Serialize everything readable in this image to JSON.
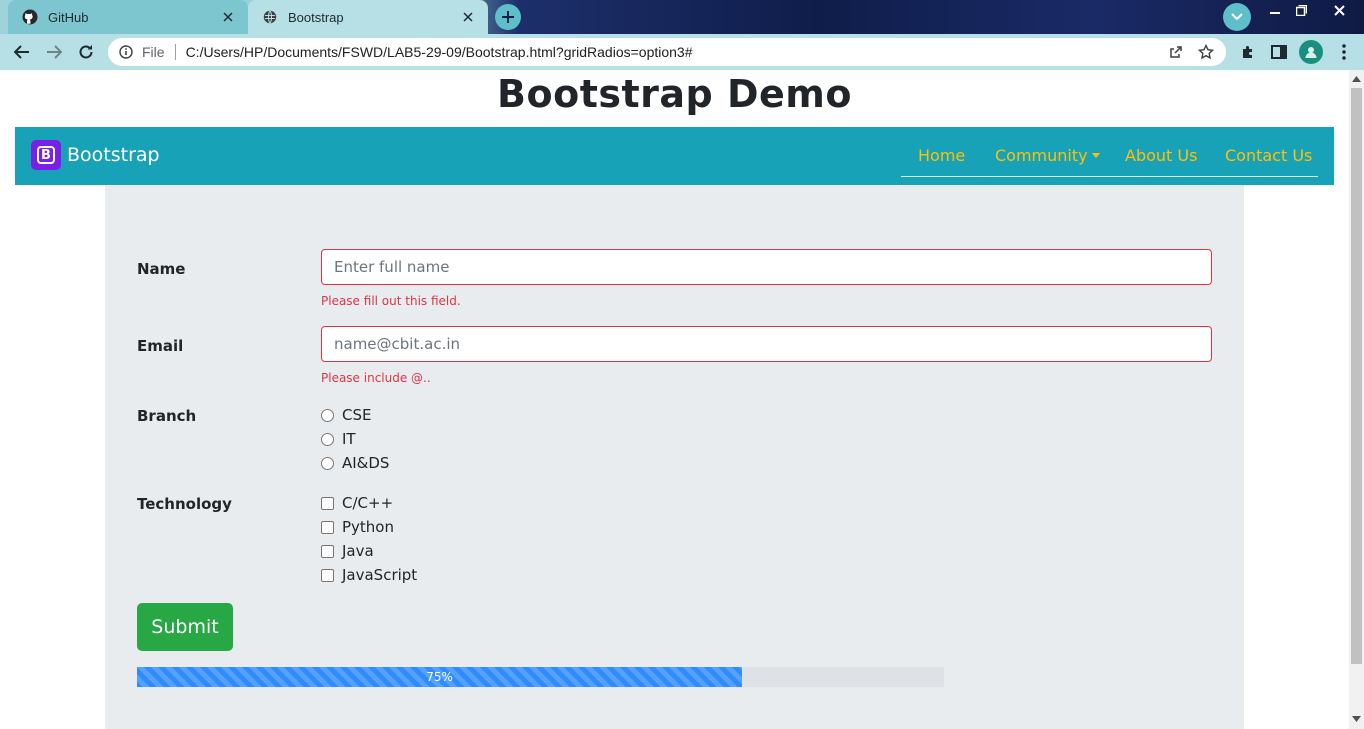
{
  "browser": {
    "tabs": [
      {
        "title": "GitHub",
        "icon": "github-icon",
        "active": false
      },
      {
        "title": "Bootstrap",
        "icon": "globe-icon",
        "active": true
      }
    ],
    "omnibox": {
      "scheme": "File",
      "url": "C:/Users/HP/Documents/FSWD/LAB5-29-09/Bootstrap.html?gridRadios=option3#"
    }
  },
  "page": {
    "heading": "Bootstrap Demo",
    "navbar": {
      "brand": "Bootstrap",
      "brand_logo_letter": "B",
      "links": [
        "Home",
        "Community",
        "About Us",
        "Contact Us"
      ],
      "background": "#17a2b8",
      "link_color": "#ffc107"
    },
    "form": {
      "name_label": "Name",
      "name_placeholder": "Enter full name",
      "name_feedback": "Please fill out this field.",
      "email_label": "Email",
      "email_placeholder": "name@cbit.ac.in",
      "email_feedback": "Please include @..",
      "branch_label": "Branch",
      "branches": [
        "CSE",
        "IT",
        "AI&DS"
      ],
      "technology_label": "Technology",
      "technologies": [
        "C/C++",
        "Python",
        "Java",
        "JavaScript"
      ],
      "submit_label": "Submit",
      "progress_label": "75%",
      "progress_value": 0.75
    }
  }
}
